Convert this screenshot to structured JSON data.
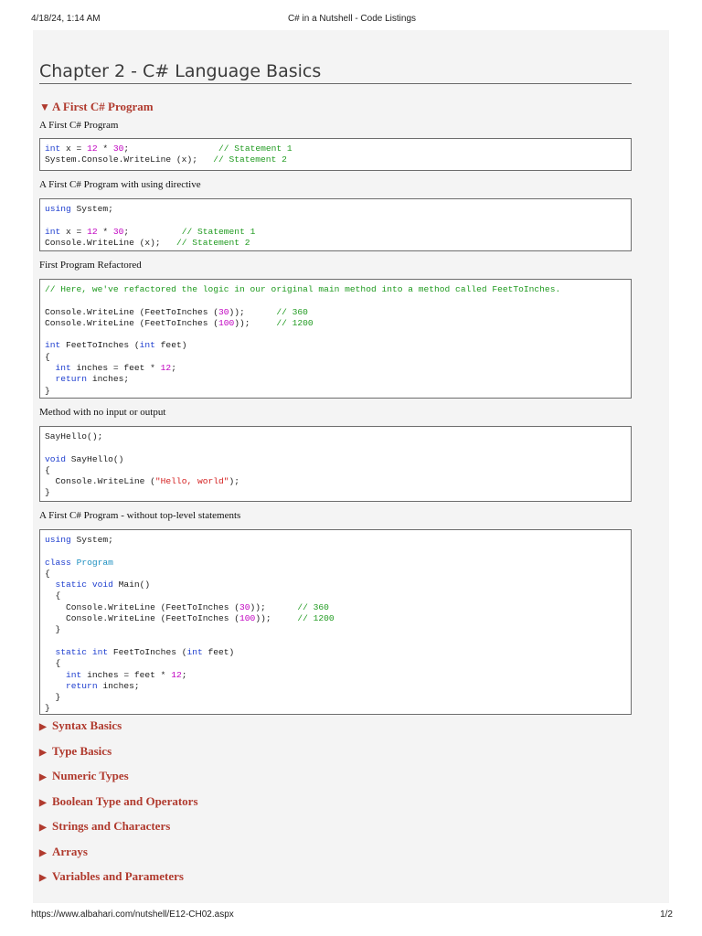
{
  "print_header": {
    "date": "4/18/24, 1:14 AM",
    "title": "C# in a Nutshell - Code Listings"
  },
  "print_footer": {
    "url": "https://www.albahari.com/nutshell/E12-CH02.aspx",
    "page": "1/2"
  },
  "chapter": {
    "title": "Chapter 2 - C# Language Basics"
  },
  "expanded_section": {
    "label": "A First C# Program",
    "icon": "triangle-down-icon",
    "listings": [
      {
        "label": "A First C# Program"
      },
      {
        "label": "A First C# Program with using directive"
      },
      {
        "label": "First Program Refactored"
      },
      {
        "label": "Method with no input or output"
      },
      {
        "label": "A First C# Program - without top-level statements"
      }
    ]
  },
  "collapsed_sections": [
    {
      "label": "Syntax Basics",
      "icon": "triangle-right-icon"
    },
    {
      "label": "Type Basics",
      "icon": "triangle-right-icon"
    },
    {
      "label": "Numeric Types",
      "icon": "triangle-right-icon"
    },
    {
      "label": "Boolean Type and Operators",
      "icon": "triangle-right-icon"
    },
    {
      "label": "Strings and Characters",
      "icon": "triangle-right-icon"
    },
    {
      "label": "Arrays",
      "icon": "triangle-right-icon"
    },
    {
      "label": "Variables and Parameters",
      "icon": "triangle-right-icon"
    }
  ],
  "code": {
    "l1": {
      "line1": {
        "kw": "int",
        "a": " x = ",
        "n1": "12",
        "b": " * ",
        "n2": "30",
        "c": ";                 ",
        "cm": "// Statement 1"
      },
      "line2": {
        "a": "System.Console.WriteLine (x);   ",
        "cm": "// Statement 2"
      }
    },
    "l2": {
      "line1": {
        "kw": "using",
        "a": " System;"
      },
      "line3": {
        "kw": "int",
        "a": " x = ",
        "n1": "12",
        "b": " * ",
        "n2": "30",
        "c": ";          ",
        "cm": "// Statement 1"
      },
      "line4": {
        "a": "Console.WriteLine (x);   ",
        "cm": "// Statement 2"
      }
    },
    "l3": {
      "line1": {
        "cm": "// Here, we've refactored the logic in our original main method into a method called FeetToInches."
      },
      "line3": {
        "a": "Console.WriteLine (FeetToInches (",
        "n": "30",
        "b": "));      ",
        "cm": "// 360"
      },
      "line4": {
        "a": "Console.WriteLine (FeetToInches (",
        "n": "100",
        "b": "));     ",
        "cm": "// 1200"
      },
      "line6": {
        "kw1": "int",
        "a": " FeetToInches (",
        "kw2": "int",
        "b": " feet)"
      },
      "line7": "{",
      "line8": {
        "pre": "  ",
        "kw": "int",
        "a": " inches = feet * ",
        "n": "12",
        "b": ";"
      },
      "line9": {
        "pre": "  ",
        "kw": "return",
        "a": " inches;"
      },
      "line10": "}"
    },
    "l4": {
      "line1": "SayHello();",
      "line3": {
        "kw": "void",
        "a": " SayHello()"
      },
      "line4": "{",
      "line5": {
        "a": "  Console.WriteLine (",
        "s": "\"Hello, world\"",
        "b": ");"
      },
      "line6": "}"
    },
    "l5": {
      "line1": {
        "kw": "using",
        "a": " System;"
      },
      "line3": {
        "kw": "class",
        "a": " ",
        "ty": "Program"
      },
      "line4": "{",
      "line5": {
        "pre": "  ",
        "kw1": "static",
        "sp": " ",
        "kw2": "void",
        "a": " Main()"
      },
      "line6": "  {",
      "line7": {
        "a": "    Console.WriteLine (FeetToInches (",
        "n": "30",
        "b": "));      ",
        "cm": "// 360"
      },
      "line8": {
        "a": "    Console.WriteLine (FeetToInches (",
        "n": "100",
        "b": "));     ",
        "cm": "// 1200"
      },
      "line9": "  }",
      "line11": {
        "pre": "  ",
        "kw1": "static",
        "sp": " ",
        "kw2": "int",
        "a": " FeetToInches (",
        "kw3": "int",
        "b": " feet)"
      },
      "line12": "  {",
      "line13": {
        "pre": "    ",
        "kw": "int",
        "a": " inches = feet * ",
        "n": "12",
        "b": ";"
      },
      "line14": {
        "pre": "    ",
        "kw": "return",
        "a": " inches;"
      },
      "line15": "  }",
      "line16": "}"
    }
  }
}
